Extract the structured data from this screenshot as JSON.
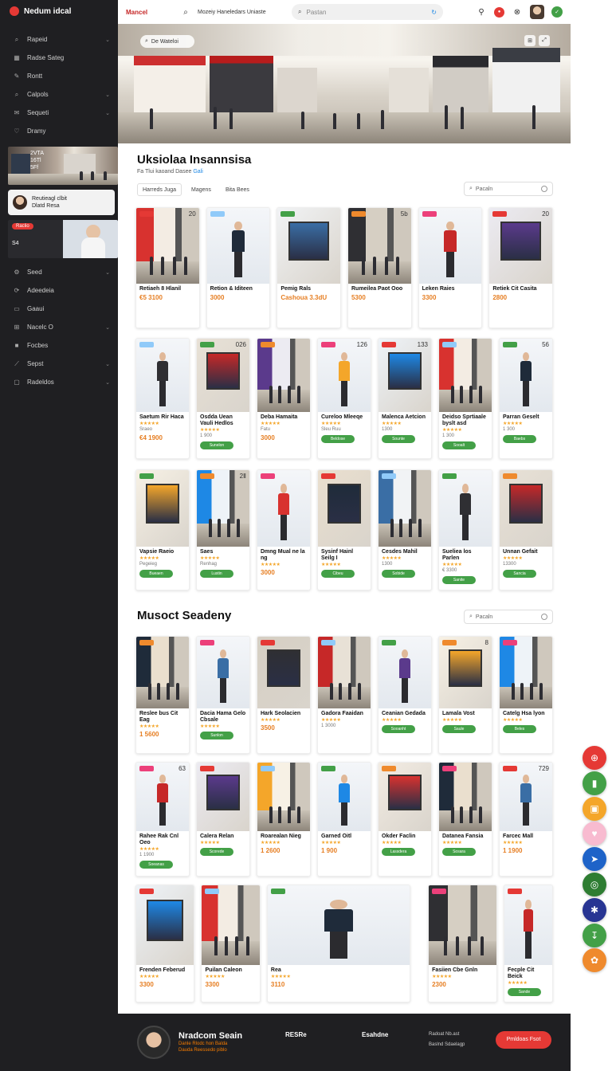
{
  "app": {
    "logo_text": "Nedum idcal"
  },
  "sidebar": {
    "nav_top": [
      {
        "icon": "tag-icon",
        "glyph": "⌕",
        "label": "Rapeid"
      },
      {
        "icon": "layout-icon",
        "glyph": "▦",
        "label": "Radse Sateg"
      },
      {
        "icon": "shop-icon",
        "glyph": "✎",
        "label": "Rontt"
      },
      {
        "icon": "search-icon",
        "glyph": "⌕",
        "label": "Calpols"
      },
      {
        "icon": "mail-icon",
        "glyph": "✉",
        "label": "Sequeti"
      },
      {
        "icon": "heart-icon",
        "glyph": "♡",
        "label": "Dramy"
      }
    ],
    "promo": {
      "line1": "2VTA",
      "line2": "16Tl",
      "line3": "5Ff"
    },
    "active_card": {
      "line1": "Reutieagl clbit",
      "line2": "Dlatd Resa"
    },
    "promo2": {
      "pill": "Raclio",
      "line": "S4"
    },
    "nav_bottom": [
      {
        "icon": "settings-icon",
        "glyph": "⚙",
        "label": "Seed"
      },
      {
        "icon": "chart-icon",
        "glyph": "⟳",
        "label": "Adeedeia"
      },
      {
        "icon": "card-icon",
        "glyph": "▭",
        "label": "Gaaui"
      },
      {
        "icon": "store-icon",
        "glyph": "⊞",
        "label": "Nacelc O"
      },
      {
        "icon": "folder-icon",
        "glyph": "■",
        "label": "Focbes"
      },
      {
        "icon": "graph-icon",
        "glyph": "⟋",
        "label": "Sepst"
      },
      {
        "icon": "monitor-icon",
        "glyph": "▢",
        "label": "Radeldos"
      }
    ]
  },
  "topbar": {
    "brand": "Mancel",
    "title": "Mozeiy Haneledars Uniaste",
    "search_placeholder": "Pastan"
  },
  "hero": {
    "search": "De Wateloi"
  },
  "section1": {
    "title": "Uksiolaa Insannsisa",
    "subtitle": "Fa Tlui kaoand Dasee",
    "subtitle_link": "Gali",
    "chips": [
      "Harreds Juga",
      "Magens",
      "Bita Bees"
    ],
    "filter": "Pacaln"
  },
  "section2": {
    "title": "Musoct Seadeny",
    "filter": "Pacaln"
  },
  "rows": [
    {
      "cards": [
        {
          "name": "Retiaeh 8 Hlanil",
          "meta": "",
          "price": "€5 3100",
          "num": "20",
          "btn": ""
        },
        {
          "name": "Retion & Iditeen",
          "meta": "",
          "price": "3000",
          "num": "",
          "btn": ""
        },
        {
          "name": "Pemig Rals",
          "meta": "",
          "price": "Cashoua 3.3dU",
          "num": "",
          "btn": ""
        },
        {
          "name": "Rumeilea Paot Ooo",
          "meta": "",
          "price": "5300",
          "num": "5b",
          "btn": ""
        },
        {
          "name": "Leken Raies",
          "meta": "",
          "price": "3300",
          "num": "",
          "btn": ""
        },
        {
          "name": "Retiek Cit Casita",
          "meta": "",
          "price": "2800",
          "num": "20",
          "btn": ""
        }
      ]
    },
    {
      "cards": [
        {
          "name": "Saetum Rir Haca",
          "meta": "Sraeo",
          "price": "€4 1900",
          "num": "",
          "btn": ""
        },
        {
          "name": "Osdda Uean Vauli Hedlos",
          "meta": "1 900",
          "price": "",
          "num": "026",
          "btn": "Sunelon"
        },
        {
          "name": "Deba Hamaita",
          "meta": "Fatu",
          "price": "3000",
          "num": "",
          "btn": ""
        },
        {
          "name": "Cureloo Mleeqe",
          "meta": "Sleu Ruu",
          "price": "",
          "num": "126",
          "btn": "Beldose"
        },
        {
          "name": "Malenca Aetcion",
          "meta": "1300",
          "price": "",
          "num": "133",
          "btn": "Sounte"
        },
        {
          "name": "Deidso Sprtiaale byslt asd",
          "meta": "1 300",
          "price": "",
          "num": "",
          "btn": "Sooalt"
        },
        {
          "name": "Parran Geselt",
          "meta": "1 300",
          "price": "",
          "num": "56",
          "btn": "Baebs"
        }
      ]
    },
    {
      "cards": [
        {
          "name": "Vapsie Raeio",
          "meta": "Pegeieg",
          "price": "",
          "num": "",
          "btn": "Bueaen"
        },
        {
          "name": "Saes",
          "meta": "Renhag",
          "price": "",
          "num": "2Ⅱ",
          "btn": "Lustin"
        },
        {
          "name": "Dmng Mual ne la ng",
          "meta": "",
          "price": "3000",
          "num": "",
          "btn": ""
        },
        {
          "name": "Sysinf Hainl Seilg I",
          "meta": "",
          "price": "",
          "num": "",
          "btn": "Cibeu"
        },
        {
          "name": "Cesdes Mahil",
          "meta": "1300",
          "price": "",
          "num": "",
          "btn": "Sobide"
        },
        {
          "name": "Sueliea los Parlen",
          "meta": "€ 3300",
          "price": "",
          "num": "",
          "btn": "Sanite"
        },
        {
          "name": "Unnan Gefait",
          "meta": "13300",
          "price": "",
          "num": "",
          "btn": "Sancia"
        }
      ]
    },
    {
      "cards": [
        {
          "name": "Reslee bus Cit Eag",
          "meta": "",
          "price": "1 5600",
          "num": "",
          "btn": ""
        },
        {
          "name": "Dacia Hama Gelo Cbsale",
          "meta": "",
          "price": "",
          "num": "",
          "btn": "Sunlon"
        },
        {
          "name": "Hark Seolacien",
          "meta": "",
          "price": "3500",
          "num": "",
          "btn": ""
        },
        {
          "name": "Gadora Faaidan",
          "meta": "1 3000",
          "price": "",
          "num": "",
          "btn": ""
        },
        {
          "name": "Ceanian Gedada",
          "meta": "",
          "price": "",
          "num": "",
          "btn": "Sooanht"
        },
        {
          "name": "Lamala Vost",
          "meta": "",
          "price": "",
          "num": "8",
          "btn": "Saule"
        },
        {
          "name": "Catelg Hsa lyon",
          "meta": "",
          "price": "",
          "num": "",
          "btn": "Beles"
        }
      ]
    },
    {
      "cards": [
        {
          "name": "Rahee Rak Cnl Oeo",
          "meta": "1 1900",
          "price": "",
          "num": "63",
          "btn": "Soeanas"
        },
        {
          "name": "Calera Relan",
          "meta": "",
          "price": "",
          "num": "",
          "btn": "Scorede"
        },
        {
          "name": "Roarealan Nieg",
          "meta": "",
          "price": "1 2600",
          "num": "",
          "btn": ""
        },
        {
          "name": "Garned Oitl",
          "meta": "",
          "price": "1 900",
          "num": "",
          "btn": ""
        },
        {
          "name": "Okder Faclin",
          "meta": "",
          "price": "",
          "num": "",
          "btn": "Lassdera"
        },
        {
          "name": "Datanea Fansia",
          "meta": "",
          "price": "",
          "num": "",
          "btn": "Sosara"
        },
        {
          "name": "Farcec Mall",
          "meta": "",
          "price": "1 1900",
          "num": "729",
          "btn": ""
        }
      ]
    },
    {
      "cards": [
        {
          "name": "Frenden Feberud",
          "meta": "",
          "price": "3300",
          "num": "",
          "btn": ""
        },
        {
          "name": "Puilan Caleon",
          "meta": "",
          "price": "3300",
          "num": "",
          "btn": ""
        },
        {
          "name": "Rea",
          "meta": "",
          "price": "3110",
          "num": "",
          "btn": ""
        },
        {
          "name": "Rea",
          "meta": "",
          "price": "",
          "num": "",
          "btn": ""
        },
        {
          "name": "Fasiien Cbe Gnln",
          "meta": "",
          "price": "2300",
          "num": "",
          "btn": ""
        },
        {
          "name": "Fecple Cit Beick",
          "meta": "",
          "price": "",
          "num": "",
          "btn": "Sande"
        }
      ]
    }
  ],
  "footer": {
    "name": "Nradcom Seain",
    "sub1": "Danle Rlodc hon Balda",
    "sub2": "Dauda Reessedo piblo",
    "col1": "RESRe",
    "col2": "Esahdne",
    "links": [
      "Radoat Nb.ast",
      "Baslnd Sdaelagp"
    ],
    "cta": "Pmldoas Fsot"
  },
  "fab_colors": [
    "#e53935",
    "#43a047",
    "#f4a62a",
    "#f8bbd0",
    "#1e63c8",
    "#2e7d32",
    "#283593",
    "#43a047",
    "#ef8a2d"
  ],
  "accent": "#e53935"
}
